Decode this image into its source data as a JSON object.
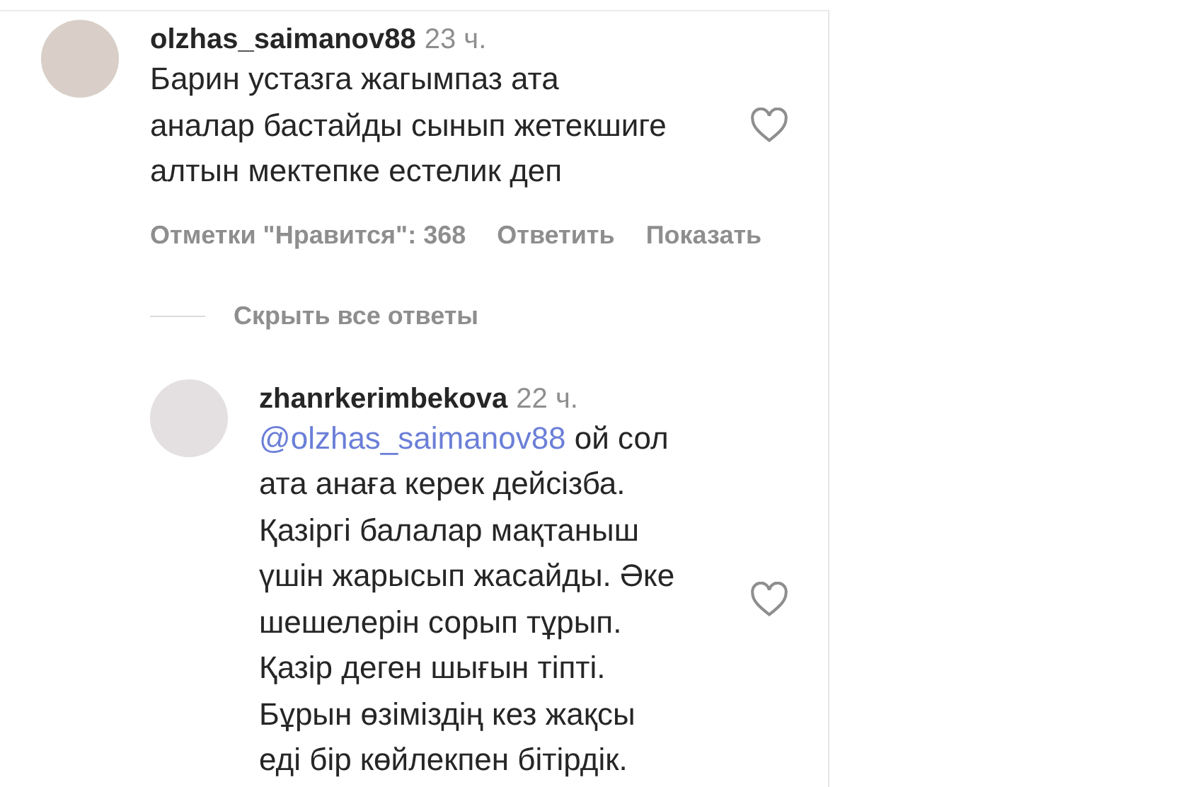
{
  "comment": {
    "author": "olzhas_saimanov88",
    "time": "23 ч.",
    "lines": [
      "Барин устазга жагымпаз ата",
      "аналар бастайды сынып жетекшиге",
      "алтын мектепке естелик деп"
    ],
    "liked": false,
    "actions": [
      "Отметки \"Нравится\": 368",
      "Ответить",
      "Показать"
    ]
  },
  "hide_replies": "Скрыть все ответы",
  "reply": {
    "author": "zhanrkerimbekova",
    "time": "22 ч.",
    "mention": "@olzhas_saimanov88",
    "lines": [
      " ой сол",
      "ата анаға керек дейсізба.",
      "Қазіргі балалар мақтаныш",
      "үшін жарысып жасайды. Әке",
      "шешелерін сорып тұрып.",
      "Қазір деген шығын тіпті.",
      "Бұрын өзіміздің кез жақсы",
      "еді бір көйлекпен бітірдік."
    ],
    "liked": false
  }
}
